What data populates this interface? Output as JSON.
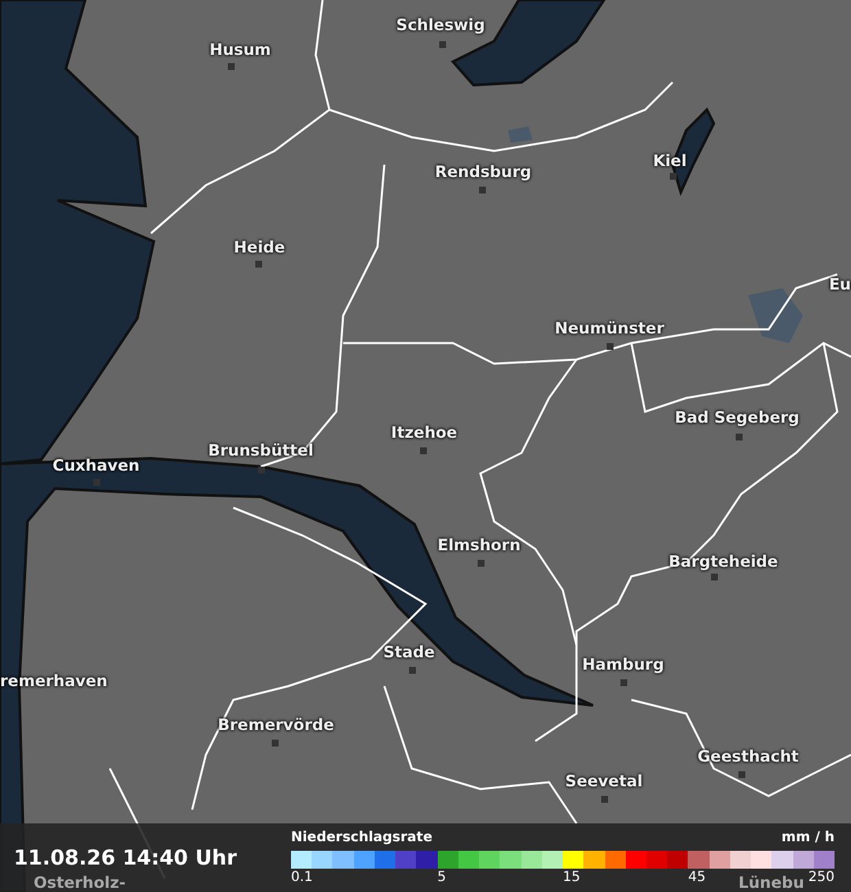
{
  "map": {
    "places": [
      {
        "name": "Schleswig"
      },
      {
        "name": "Husum"
      },
      {
        "name": "Rendsburg"
      },
      {
        "name": "Kiel"
      },
      {
        "name": "Heide"
      },
      {
        "name": "Eu"
      },
      {
        "name": "Neumünster"
      },
      {
        "name": "Bad Segeberg"
      },
      {
        "name": "Itzehoe"
      },
      {
        "name": "Brunsbüttel"
      },
      {
        "name": "Cuxhaven"
      },
      {
        "name": "Elmshorn"
      },
      {
        "name": "Bargteheide"
      },
      {
        "name": "Hamburg"
      },
      {
        "name": "Stade"
      },
      {
        "name": "remerhaven"
      },
      {
        "name": "Bremervörde"
      },
      {
        "name": "Geesthacht"
      },
      {
        "name": "Seevetal"
      },
      {
        "name": "Osterholz-"
      },
      {
        "name": "Lünebu"
      }
    ]
  },
  "legend": {
    "timestamp": "11.08.26 14:40 Uhr",
    "title": "Niederschlagsrate",
    "unit": "mm / h",
    "end_tick": "250",
    "swatches": [
      {
        "color": "#b3ecff",
        "tick": "0.1"
      },
      {
        "color": "#99d6ff"
      },
      {
        "color": "#80bfff"
      },
      {
        "color": "#4da3ff"
      },
      {
        "color": "#1f6fe8"
      },
      {
        "color": "#5040c8"
      },
      {
        "color": "#2f1fa8"
      },
      {
        "color": "#2da52d",
        "tick": "5"
      },
      {
        "color": "#44c844"
      },
      {
        "color": "#5fd45f"
      },
      {
        "color": "#7be07b"
      },
      {
        "color": "#99e899"
      },
      {
        "color": "#b3f0b3"
      },
      {
        "color": "#ffff00",
        "tick": "15"
      },
      {
        "color": "#ffb300"
      },
      {
        "color": "#ff6a00"
      },
      {
        "color": "#ff0000"
      },
      {
        "color": "#e00000"
      },
      {
        "color": "#c00000"
      },
      {
        "color": "#c06060",
        "tick": "45"
      },
      {
        "color": "#e0a0a0"
      },
      {
        "color": "#f0d0d0"
      },
      {
        "color": "#ffe0e0"
      },
      {
        "color": "#dcd0ec"
      },
      {
        "color": "#c0a8d8"
      },
      {
        "color": "#a080c8"
      }
    ]
  }
}
